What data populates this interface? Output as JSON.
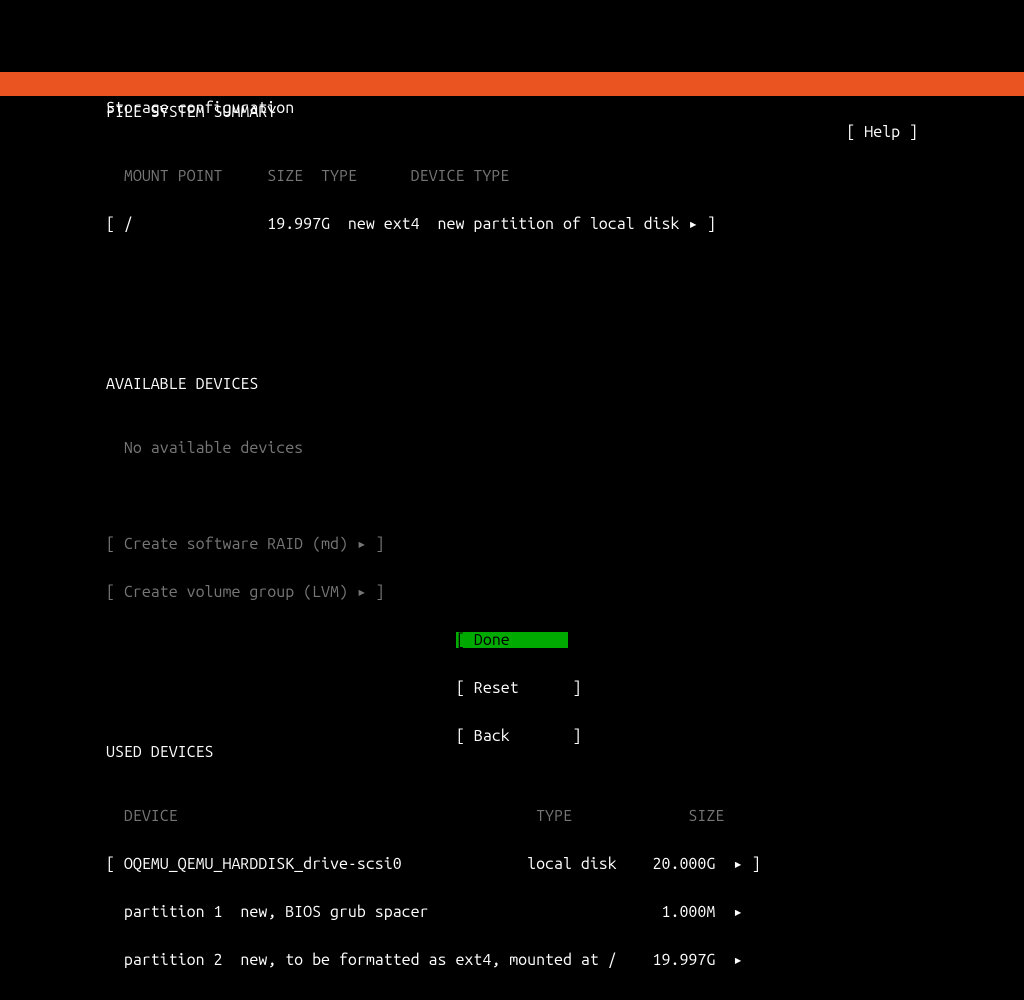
{
  "header": {
    "title": "Storage configuration",
    "help": "[ Help ]"
  },
  "fs_summary": {
    "heading": "FILE SYSTEM SUMMARY",
    "col_mount": "MOUNT POINT",
    "col_size": "SIZE",
    "col_type": "TYPE",
    "col_devtype": "DEVICE TYPE",
    "rows": [
      {
        "line": "[ /               19.997G  new ext4  new partition of local disk ▸ ]"
      }
    ]
  },
  "avail": {
    "heading": "AVAILABLE DEVICES",
    "none": "No available devices",
    "raid_line": "[ Create software RAID (md) ▸ ]",
    "lvm_line": "[ Create volume group (LVM) ▸ ]"
  },
  "used": {
    "heading": "USED DEVICES",
    "col_device": "DEVICE",
    "col_type": "TYPE",
    "col_size": "SIZE",
    "device_row": "[ OQEMU_QEMU_HARDDISK_drive-scsi0              local disk    20.000G  ▸ ]",
    "p1_row": "  partition 1  new, BIOS grub spacer                          1.000M  ▸  ",
    "p2_row": "  partition 2  new, to be formatted as ext4, mounted at /    19.997G  ▸  "
  },
  "buttons": {
    "done": "[ Done       ]",
    "reset": "[ Reset      ]",
    "back": "[ Back       ]"
  }
}
